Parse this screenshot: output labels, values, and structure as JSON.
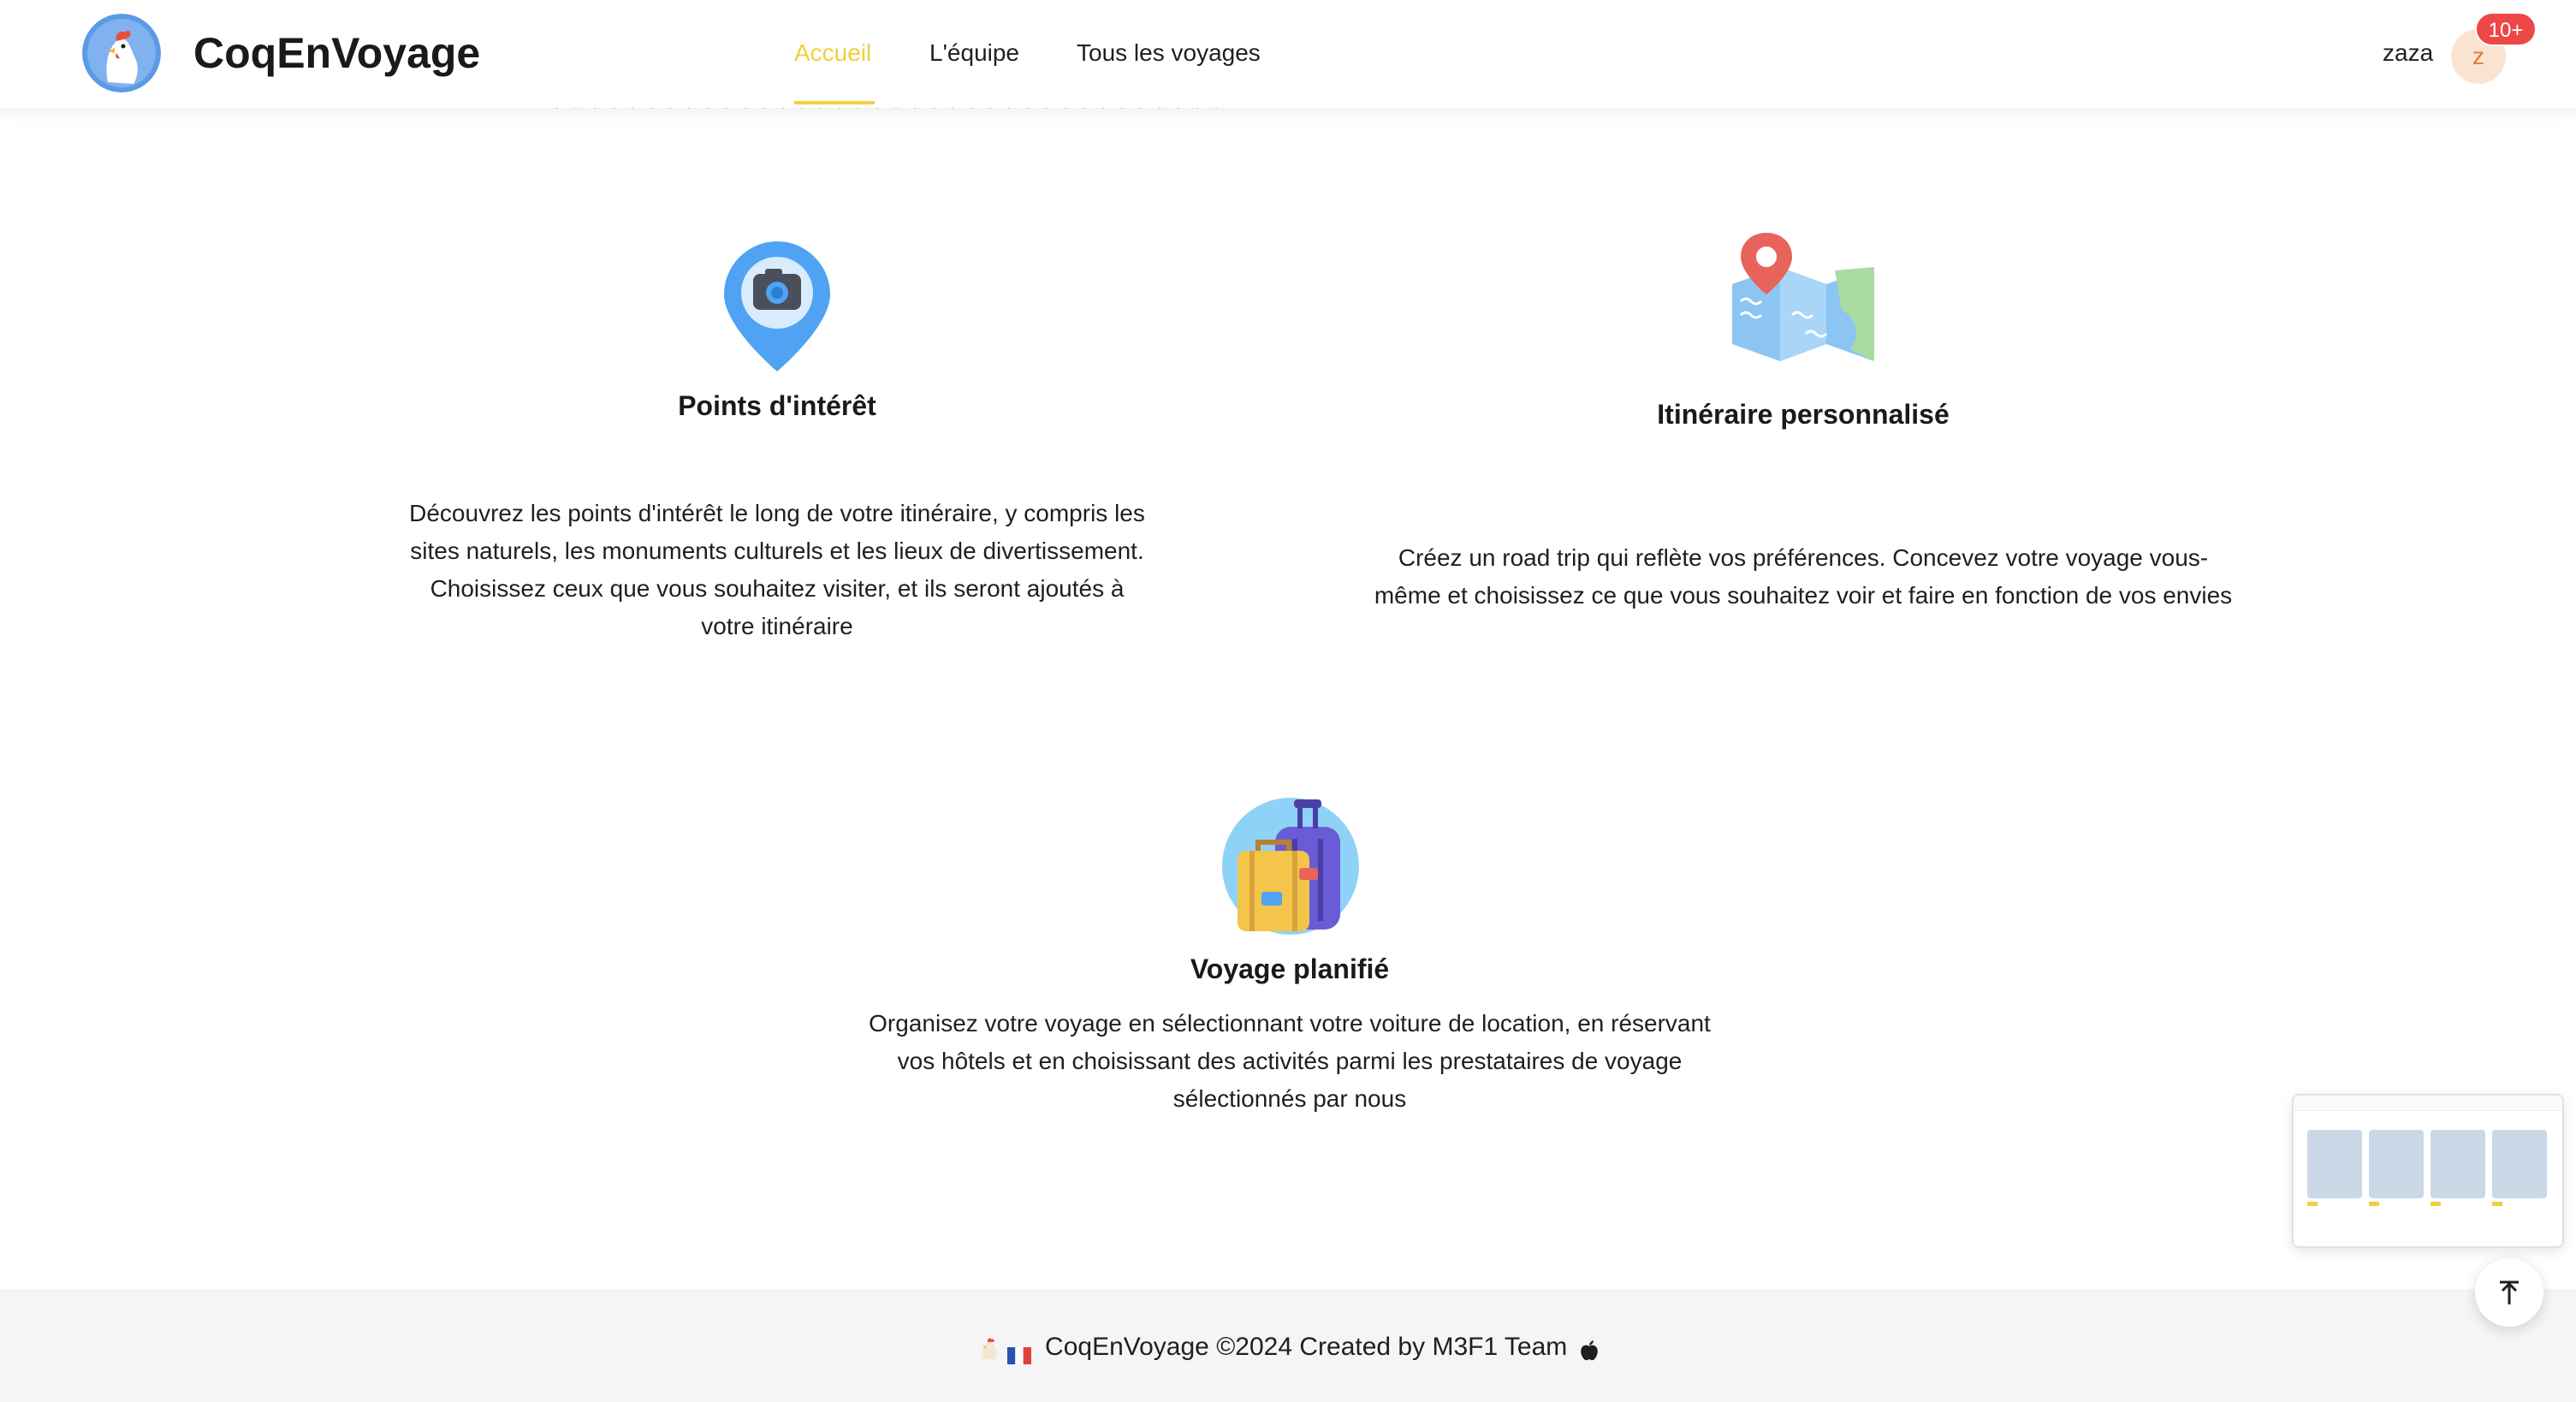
{
  "header": {
    "brand": "CoqEnVoyage",
    "nav": [
      {
        "label": "Accueil",
        "active": true
      },
      {
        "label": "L'équipe",
        "active": false
      },
      {
        "label": "Tous les voyages",
        "active": false
      }
    ],
    "user": {
      "name": "zaza",
      "avatar_letter": "z",
      "badge": "10+"
    }
  },
  "features": [
    {
      "title": "Points d'intérêt",
      "text": "Découvrez les points d'intérêt le long de votre itinéraire, y compris les sites naturels, les monuments culturels et les lieux de divertissement. Choisissez ceux que vous souhaitez visiter, et ils seront ajoutés à votre itinéraire",
      "icon": "camera-pin-icon"
    },
    {
      "title": "Itinéraire personnalisé",
      "text": "Créez un road trip qui reflète vos préférences. Concevez votre voyage vous-même et choisissez ce que vous souhaitez voir et faire en fonction de vos envies",
      "icon": "map-pin-icon"
    },
    {
      "title": "Voyage planifié",
      "text": "Organisez votre voyage en sélectionnant votre voiture de location, en réservant vos hôtels et en choisissant des activités parmi les prestataires de voyage sélectionnés par nous",
      "icon": "suitcase-icon"
    }
  ],
  "footer": {
    "text": "CoqEnVoyage ©2024 Created by M3F1 Team",
    "icons": [
      "rooster-icon",
      "france-flag-icon",
      "apple-icon"
    ]
  },
  "colors": {
    "accent": "#f1cf3d",
    "badge": "#ee4747",
    "avatar_bg": "#fbe3d2",
    "footer_bg": "#f5f5f5"
  }
}
